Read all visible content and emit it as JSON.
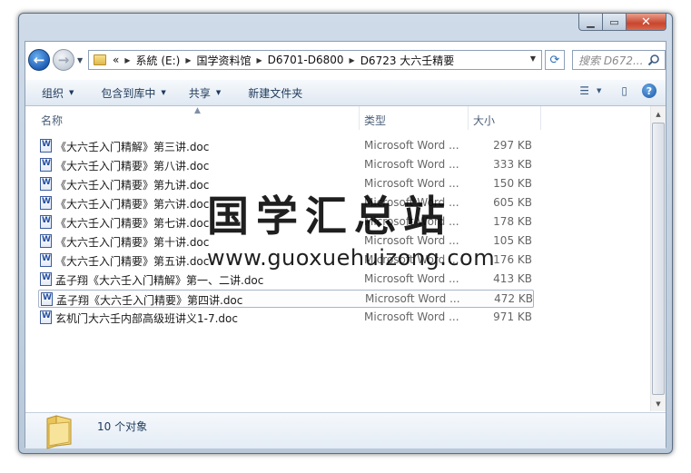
{
  "address": {
    "overflow": "«",
    "segments": [
      "系統 (E:)",
      "国学资料馆",
      "D6701-D6800",
      "D6723 大六壬精要"
    ]
  },
  "search": {
    "placeholder": "搜索 D672..."
  },
  "toolbar": {
    "organize": "组织",
    "include_in_library": "包含到库中",
    "share": "共享",
    "new_folder": "新建文件夹"
  },
  "columns": {
    "name": "名称",
    "type": "类型",
    "size": "大小"
  },
  "files": [
    {
      "name": "《大六壬入门精解》第三讲.doc",
      "type": "Microsoft Word ...",
      "size": "297 KB"
    },
    {
      "name": "《大六壬入门精要》第八讲.doc",
      "type": "Microsoft Word ...",
      "size": "333 KB"
    },
    {
      "name": "《大六壬入门精要》第九讲.doc",
      "type": "Microsoft Word ...",
      "size": "150 KB"
    },
    {
      "name": "《大六壬入门精要》第六讲.doc",
      "type": "Microsoft Word ...",
      "size": "605 KB"
    },
    {
      "name": "《大六壬入门精要》第七讲.doc",
      "type": "Microsoft Word ...",
      "size": "178 KB"
    },
    {
      "name": "《大六壬入门精要》第十讲.doc",
      "type": "Microsoft Word ...",
      "size": "105 KB"
    },
    {
      "name": "《大六壬入门精要》第五讲.doc",
      "type": "Microsoft Word ...",
      "size": "176 KB"
    },
    {
      "name": "孟子翔《大六壬入门精解》第一、二讲.doc",
      "type": "Microsoft Word ...",
      "size": "413 KB"
    },
    {
      "name": "孟子翔《大六壬入门精要》第四讲.doc",
      "type": "Microsoft Word ...",
      "size": "472 KB"
    },
    {
      "name": "玄机门大六壬内部高级班讲义1-7.doc",
      "type": "Microsoft Word ...",
      "size": "971 KB"
    }
  ],
  "selected_index": 8,
  "watermark": {
    "text": "国学汇总站",
    "url": "www.guoxuehuizong.com"
  },
  "details": {
    "count": "10 个对象"
  }
}
